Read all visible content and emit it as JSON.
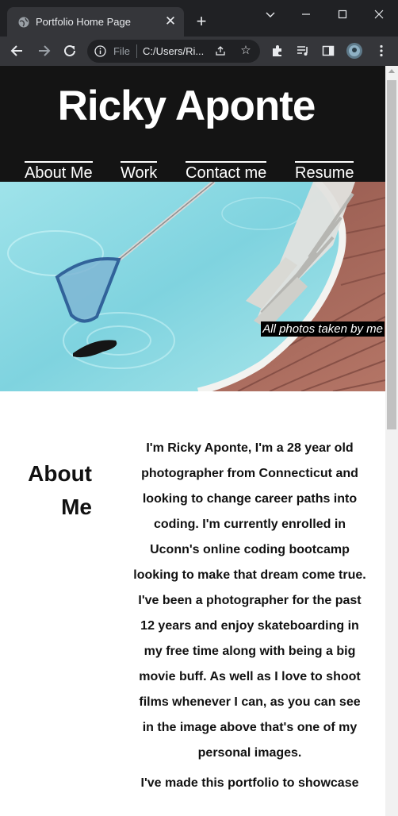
{
  "browser": {
    "tab_title": "Portfolio Home Page",
    "omnibox_prefix": "File",
    "url": "C:/Users/Ri...",
    "icons": [
      "globe-icon",
      "close-icon",
      "plus-icon",
      "chevron-down-icon",
      "minimize-icon",
      "maximize-icon",
      "close-window-icon",
      "back-arrow-icon",
      "forward-arrow-icon",
      "reload-icon",
      "info-icon",
      "share-icon",
      "star-icon",
      "extensions-icon",
      "media-icon",
      "sidebar-icon",
      "profile-avatar-icon",
      "more-vert-icon"
    ]
  },
  "site": {
    "name": "Ricky Aponte",
    "nav": [
      "About Me",
      "Work",
      "Contact me",
      "Resume"
    ],
    "hero_caption": "All photos taken by me"
  },
  "about": {
    "heading": "About Me",
    "paragraph1": "I'm Ricky Aponte, I'm a 28 year old photographer from Connecticut and looking to change career paths into coding. I'm currently enrolled in Uconn's online coding bootcamp looking to make that dream come true. I've been a photographer for the past 12 years and enjoy skateboarding in my free time along with being a big movie buff. As well as I love to shoot films whenever I can, as you can see in the image above that's one of my personal images.",
    "paragraph2": "I've made this portfolio to showcase"
  },
  "colors": {
    "header_bg": "#141414",
    "chrome_dark": "#202124",
    "chrome_toolbar": "#35363a"
  }
}
